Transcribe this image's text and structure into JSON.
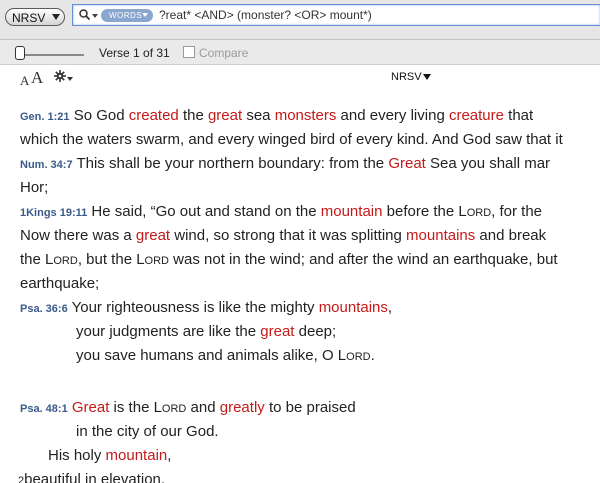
{
  "toolbar": {
    "version_button": "NRSV",
    "words_pill": "WORDS",
    "search_query": "?reat* <AND> (monster? <OR> mount*)"
  },
  "nav": {
    "verse_count": "Verse 1 of 31",
    "compare_label": "Compare"
  },
  "view": {
    "font_small": "A",
    "font_large": "A",
    "version_title": "NRSV"
  },
  "passages": [
    {
      "ref": "Gen. 1:21",
      "lines": [
        [
          {
            "t": " So God "
          },
          {
            "t": "created",
            "h": true
          },
          {
            "t": " the "
          },
          {
            "t": "great",
            "h": true
          },
          {
            "t": " sea "
          },
          {
            "t": "monsters",
            "h": true
          },
          {
            "t": " and every living "
          },
          {
            "t": "creature",
            "h": true
          },
          {
            "t": " that"
          }
        ],
        [
          {
            "t": "which the waters swarm, and every winged bird of every kind. And God saw that it"
          }
        ]
      ]
    },
    {
      "ref": "Num. 34:7",
      "lines": [
        [
          {
            "t": "   This shall be your northern boundary: from the "
          },
          {
            "t": "Great",
            "h": true
          },
          {
            "t": " Sea you shall mar"
          }
        ],
        [
          {
            "t": "Hor;"
          }
        ]
      ]
    },
    {
      "ref": "1Kings 19:11",
      "lines": [
        [
          {
            "t": "   He said, “Go out and stand on the "
          },
          {
            "t": "mountain",
            "h": true
          },
          {
            "t": " before the L"
          },
          {
            "t": "ORD",
            "sc": true
          },
          {
            "t": ", for the"
          }
        ],
        [
          {
            "t": "Now there was a "
          },
          {
            "t": "great",
            "h": true
          },
          {
            "t": " wind, so strong that it was splitting "
          },
          {
            "t": "mountains",
            "h": true
          },
          {
            "t": " and break"
          }
        ],
        [
          {
            "t": "the L"
          },
          {
            "t": "ORD",
            "sc": true
          },
          {
            "t": ", but the L"
          },
          {
            "t": "ORD",
            "sc": true
          },
          {
            "t": " was not in the wind; and after the wind an earthquake, but"
          }
        ],
        [
          {
            "t": "earthquake;"
          }
        ]
      ]
    },
    {
      "ref": "Psa. 36:6",
      "lines": [
        [
          {
            "t": " Your righteousness is like the mighty "
          },
          {
            "t": "mountains",
            "h": true
          },
          {
            "t": ","
          }
        ],
        [
          {
            "t": "your judgments are like the "
          },
          {
            "t": "great",
            "h": true
          },
          {
            "t": " deep;"
          }
        ],
        [
          {
            "t": "you save humans and animals alike, O L"
          },
          {
            "t": "ORD",
            "sc": true
          },
          {
            "t": "."
          }
        ]
      ]
    },
    {
      "ref": "Psa. 48:1",
      "lines": [
        [
          {
            "t": " "
          },
          {
            "t": "Great",
            "h": true
          },
          {
            "t": " is the L"
          },
          {
            "t": "ORD",
            "sc": true
          },
          {
            "t": " and "
          },
          {
            "t": "greatly",
            "h": true
          },
          {
            "t": " to be praised"
          }
        ],
        [
          {
            "t": "in the city of our God."
          }
        ],
        [
          {
            "t": "His holy "
          },
          {
            "t": "mountain",
            "h": true
          },
          {
            "t": ","
          }
        ],
        [
          {
            "t": "beautiful in elevation,",
            "num": "2"
          }
        ]
      ]
    }
  ],
  "colors": {
    "highlight": "#c41a1a",
    "reference": "#3a5a8c",
    "search_border": "#6a8fd0"
  }
}
